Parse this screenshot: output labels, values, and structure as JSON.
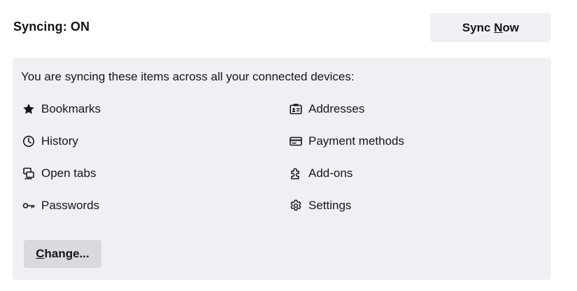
{
  "header": {
    "status": "Syncing: ON",
    "sync_now": {
      "pre": "Sync ",
      "accel": "N",
      "post": "ow"
    }
  },
  "panel": {
    "intro": "You are syncing these items across all your connected devices:",
    "left_items": [
      {
        "label": "Bookmarks",
        "icon": "star-icon"
      },
      {
        "label": "History",
        "icon": "clock-icon"
      },
      {
        "label": "Open tabs",
        "icon": "tabs-icon"
      },
      {
        "label": "Passwords",
        "icon": "key-icon"
      }
    ],
    "right_items": [
      {
        "label": "Addresses",
        "icon": "address-card-icon"
      },
      {
        "label": "Payment methods",
        "icon": "credit-card-icon"
      },
      {
        "label": "Add-ons",
        "icon": "puzzle-piece-icon"
      },
      {
        "label": "Settings",
        "icon": "gear-icon"
      }
    ],
    "change": {
      "accel": "C",
      "post": "hange..."
    }
  },
  "colors": {
    "panel_bg": "#f0f0f4",
    "button_bg": "#f0f0f4",
    "change_button_bg": "#d9d9df",
    "text": "#15141a"
  }
}
